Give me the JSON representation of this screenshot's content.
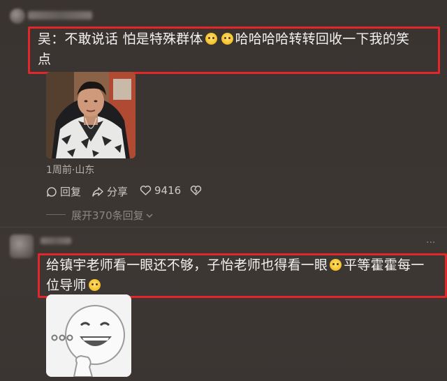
{
  "comment1": {
    "text_line1_a": "吴：不敢说话 怕是特殊群体",
    "text_line1_b": "哈哈哈哈转转回收一下我的笑",
    "text_line2": "点",
    "emoji_names": [
      "grimace-emoji-icon",
      "grimace-emoji-icon"
    ],
    "meta": "1周前·山东",
    "reply_label": "回复",
    "share_label": "分享",
    "like_count": "9416",
    "expand_label": "展开370条回复"
  },
  "comment2": {
    "text_line1_a": "给镇宇老师看一眼还不够，子怡老师也得看一眼",
    "text_line1_b": "平等霍霍每一",
    "text_line2_a": "位导师",
    "more_label": "···"
  },
  "colors": {
    "highlight_border": "#e3262a",
    "background": "#3a3431",
    "text": "#f2f2f2",
    "muted": "#b7b1ad"
  }
}
